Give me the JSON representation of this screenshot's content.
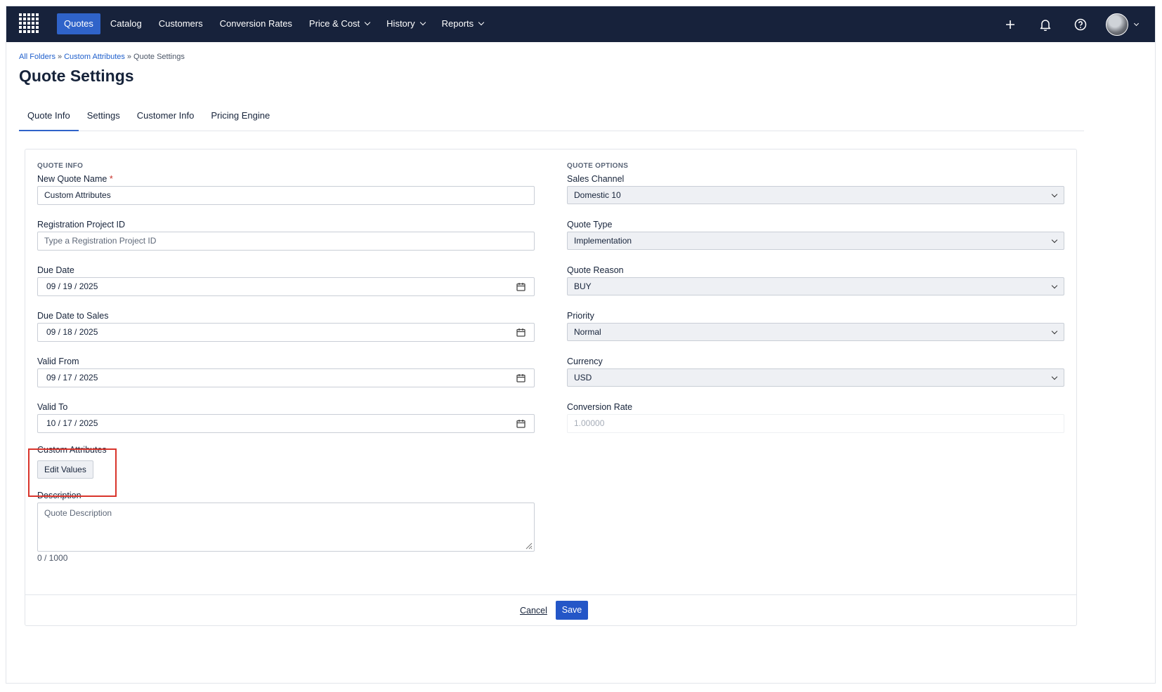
{
  "nav": {
    "items": [
      {
        "label": "Quotes",
        "active": true,
        "dropdown": false
      },
      {
        "label": "Catalog",
        "active": false,
        "dropdown": false
      },
      {
        "label": "Customers",
        "active": false,
        "dropdown": false
      },
      {
        "label": "Conversion Rates",
        "active": false,
        "dropdown": false
      },
      {
        "label": "Price & Cost",
        "active": false,
        "dropdown": true
      },
      {
        "label": "History",
        "active": false,
        "dropdown": true
      },
      {
        "label": "Reports",
        "active": false,
        "dropdown": true
      }
    ],
    "icons": [
      "app-grid-icon",
      "plus-icon",
      "bell-icon",
      "help-icon",
      "avatar"
    ]
  },
  "breadcrumb": {
    "items": [
      "All Folders",
      "Custom Attributes",
      "Quote Settings"
    ],
    "separator": "»"
  },
  "page": {
    "title": "Quote Settings"
  },
  "tabs": [
    {
      "label": "Quote Info",
      "active": true
    },
    {
      "label": "Settings",
      "active": false
    },
    {
      "label": "Customer Info",
      "active": false
    },
    {
      "label": "Pricing Engine",
      "active": false
    }
  ],
  "quote_info": {
    "section_label": "QUOTE INFO",
    "name_label": "New Quote Name",
    "required_mark": "*",
    "name_value": "Custom Attributes",
    "registration_label": "Registration Project ID",
    "registration_placeholder": "Type a Registration Project ID",
    "due_date_label": "Due Date",
    "due_date_value": "09 / 19 / 2025",
    "due_date_sales_label": "Due Date to Sales",
    "due_date_sales_value": "09 / 18 / 2025",
    "valid_from_label": "Valid From",
    "valid_from_value": "09 / 17 / 2025",
    "valid_to_label": "Valid To",
    "valid_to_value": "10 / 17 / 2025",
    "custom_attributes_label": "Custom Attributes",
    "edit_values_label": "Edit Values",
    "description_label": "Description",
    "description_placeholder": "Quote Description",
    "description_counter": "0 / 1000"
  },
  "quote_options": {
    "section_label": "QUOTE OPTIONS",
    "sales_channel_label": "Sales Channel",
    "sales_channel_value": "Domestic 10",
    "quote_type_label": "Quote Type",
    "quote_type_value": "Implementation",
    "quote_reason_label": "Quote Reason",
    "quote_reason_value": "BUY",
    "priority_label": "Priority",
    "priority_value": "Normal",
    "currency_label": "Currency",
    "currency_value": "USD",
    "conversion_rate_label": "Conversion Rate",
    "conversion_rate_value": "1.00000"
  },
  "footer": {
    "cancel_label": "Cancel",
    "save_label": "Save"
  },
  "colors": {
    "nav_bg": "#17223b",
    "accent": "#2f63c9",
    "save": "#2456c7",
    "highlight": "#d9342b"
  }
}
